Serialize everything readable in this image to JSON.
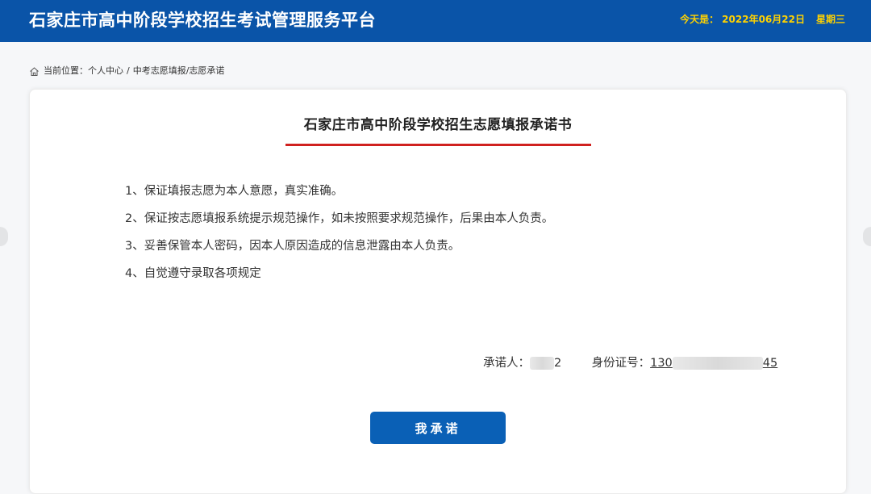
{
  "header": {
    "title": "石家庄市高中阶段学校招生考试管理服务平台",
    "date_label": "今天是：",
    "date_value": "2022年06月22日",
    "weekday": "星期三"
  },
  "breadcrumb": {
    "icon": "home-icon",
    "label": "当前位置：",
    "items": [
      "个人中心",
      "中考志愿填报/志愿承诺"
    ],
    "separator": "/"
  },
  "card": {
    "title": "石家庄市高中阶段学校招生志愿填报承诺书",
    "clauses": [
      "1、保证填报志愿为本人意愿，真实准确。",
      "2、保证按志愿填报系统提示规范操作，如未按照要求规范操作，后果由本人负责。",
      "3、妥善保管本人密码，因本人原因造成的信息泄露由本人负责。",
      "4、自觉遵守录取各项规定"
    ],
    "pledger_label": "承诺人：",
    "pledger_name_visible": "2",
    "id_label": "身份证号：",
    "id_prefix": "130",
    "id_suffix": "45",
    "button_label": "我承诺"
  },
  "colors": {
    "header_bg": "#0a54a8",
    "date_text": "#ffd200",
    "title_underline": "#d0211f",
    "button_bg": "#0a60b6"
  }
}
